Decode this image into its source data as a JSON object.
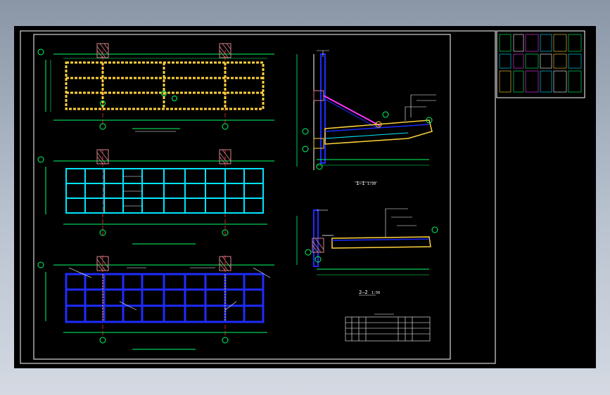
{
  "section_1_1": {
    "title": "1—1",
    "scale": "1:50"
  },
  "section_2_2": {
    "title": "2—2",
    "scale": "1:50"
  },
  "colors": {
    "background": "#000000",
    "frame": "#ffffff",
    "beam_plan": "#ffd23a",
    "grid_plan": "#00e5ff",
    "slab_plan": "#1f2bff",
    "dimension": "#00ff66",
    "axis": "#ff3030",
    "column_hatch": "#d9828a",
    "rebar": "#ff33ff",
    "desktop_gradient_top": "#8a96a6",
    "desktop_gradient_bottom": "#d4d9e2"
  },
  "icons": [
    "axis-bubble-icon",
    "column-hatch-icon",
    "section-cut-icon"
  ]
}
